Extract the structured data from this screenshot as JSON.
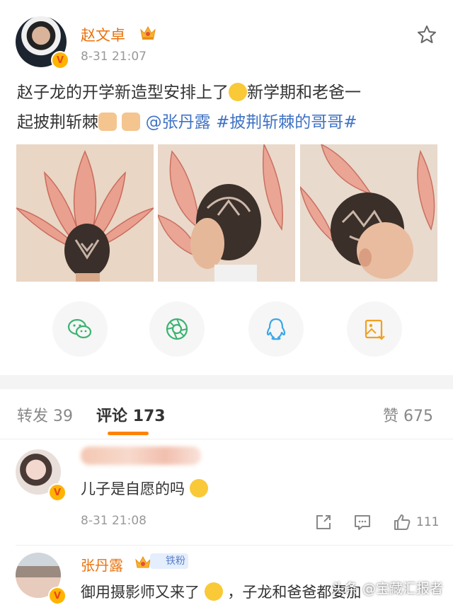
{
  "post": {
    "author": "赵文卓",
    "time": "8-31 21:07",
    "text_line1": "赵子龙的开学新造型安排上了",
    "text_line1b": "新学期和老爸一",
    "text_line2a": "起披荆斩棘",
    "mention": "@张丹露",
    "hashtag": "#披荆斩棘的哥哥#",
    "images": [
      "back-of-head-hair-design",
      "side-profile-hair-design",
      "side-back-hair-design"
    ]
  },
  "share_buttons": [
    {
      "name": "wechat-icon",
      "color": "#3cb371"
    },
    {
      "name": "moments-icon",
      "color": "#3cb371"
    },
    {
      "name": "qq-icon",
      "color": "#3ba7e8"
    },
    {
      "name": "save-image-icon",
      "color": "#f0a020"
    }
  ],
  "tabs": {
    "repost_label": "转发",
    "repost_count": "39",
    "comment_label": "评论",
    "comment_count": "173",
    "like_label": "赞",
    "like_count": "675"
  },
  "comments": [
    {
      "text": "儿子是自愿的吗",
      "time": "8-31 21:08",
      "likes": "111"
    },
    {
      "name": "张丹露",
      "badge": "铁粉",
      "text": "御用摄影师又来了",
      "text_after": "，子龙和爸爸都要加"
    }
  ],
  "watermark": "头条 @宝藏汇报者",
  "colors": {
    "accent": "#ff8200",
    "link": "#3f72c4",
    "name": "#e8720c"
  }
}
